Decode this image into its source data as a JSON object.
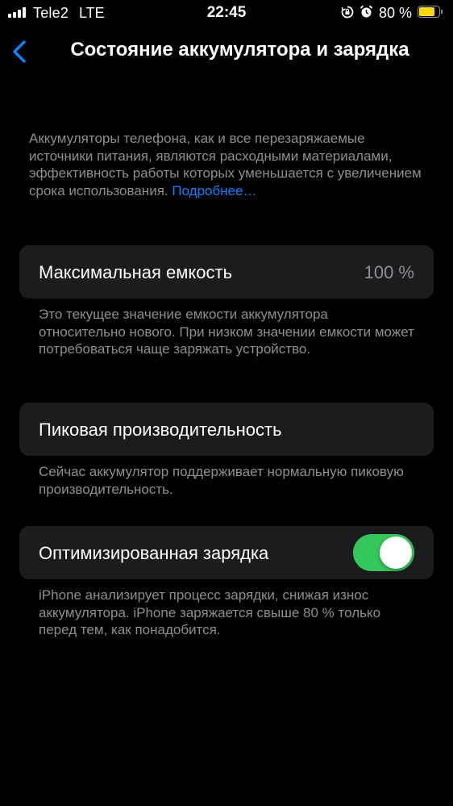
{
  "status_bar": {
    "carrier": "Tele2",
    "network": "LTE",
    "time": "22:45",
    "battery_percent": "80 %",
    "battery_level": 0.8,
    "battery_color": "#ffd60a",
    "icons": [
      "signal-icon",
      "orientation-lock-icon",
      "alarm-icon",
      "battery-icon"
    ]
  },
  "nav": {
    "back_icon": "chevron-left-icon",
    "title": "Состояние аккумулятора и зарядка"
  },
  "intro": {
    "text": "Аккумуляторы телефона, как и все перезаряжаемые источники питания, являются расходными материалами, эффективность работы которых уменьшается с увеличением срока использования.",
    "link": "Подробнее…"
  },
  "max_capacity": {
    "label": "Максимальная емкость",
    "value": "100 %",
    "footer": "Это текущее значение емкости аккумулятора относительно нового. При низком значении емкости может потребоваться чаще заряжать устройство."
  },
  "peak_performance": {
    "label": "Пиковая производительность",
    "footer": "Сейчас аккумулятор поддерживает нормальную пиковую производительность."
  },
  "optimized_charging": {
    "label": "Оптимизированная зарядка",
    "enabled": true,
    "footer": "iPhone анализирует процесс зарядки, снижая износ аккумулятора. iPhone заряжается свыше 80 % только перед тем, как понадобится."
  },
  "colors": {
    "background": "#000000",
    "cell": "#1c1c1e",
    "secondary_text": "#8e8e93",
    "link": "#0a84ff",
    "toggle_on": "#34c759"
  }
}
